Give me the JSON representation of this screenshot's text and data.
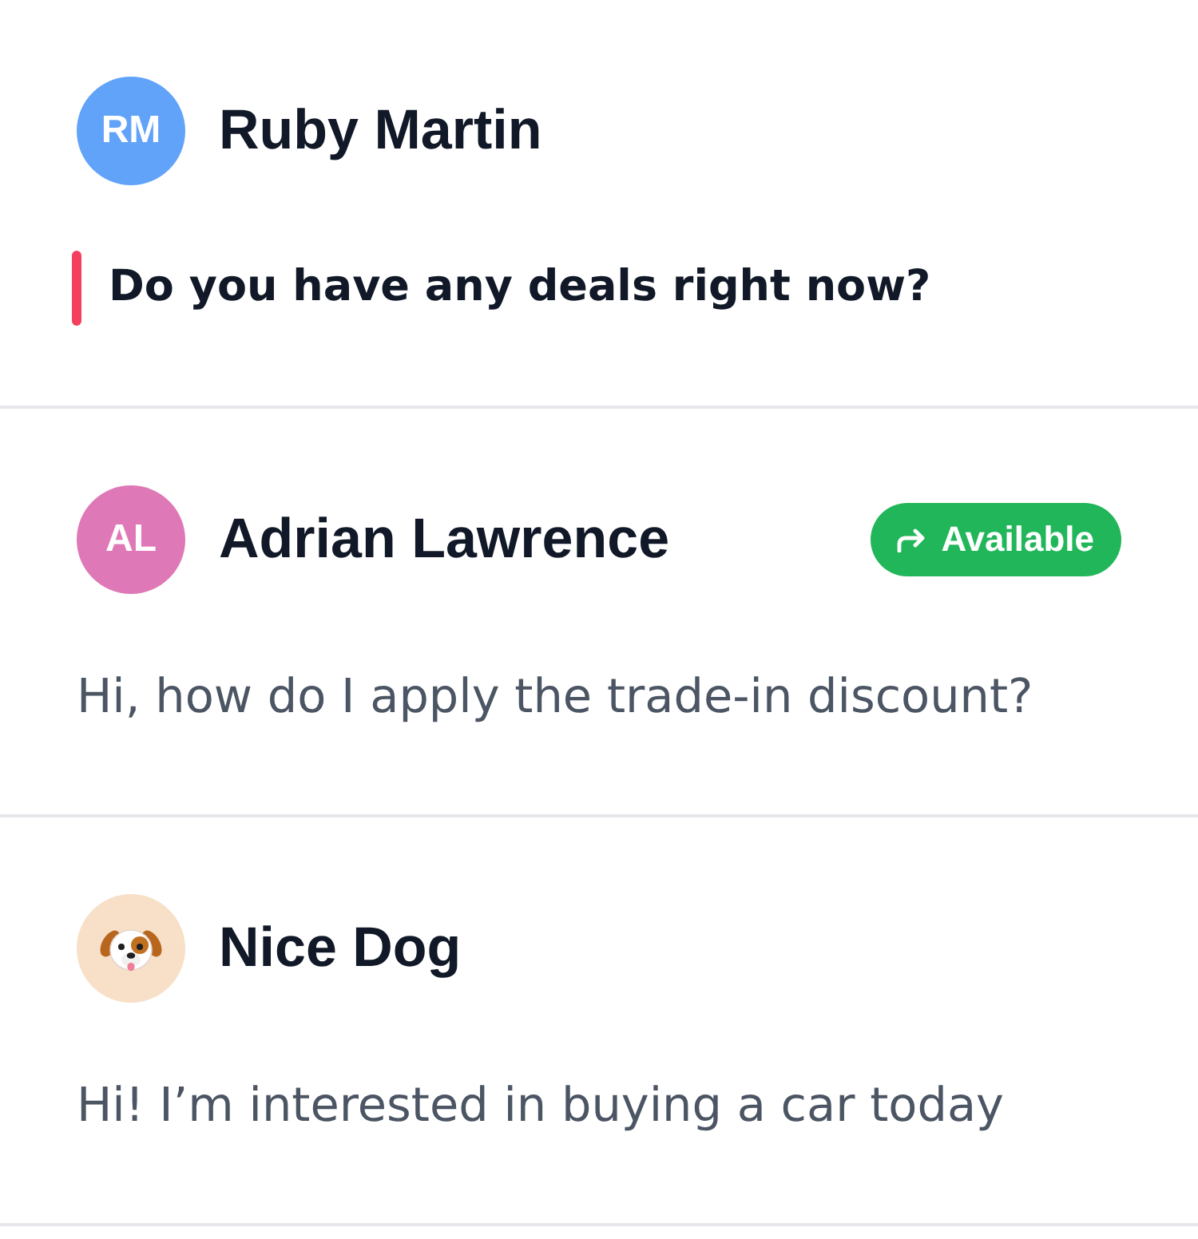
{
  "conversations": [
    {
      "name": "Ruby Martin",
      "avatar": {
        "kind": "initials",
        "text": "RM",
        "color": "#62a3fa"
      },
      "unread": true,
      "message": "Do you have any deals right now?"
    },
    {
      "name": "Adrian Lawrence",
      "avatar": {
        "kind": "initials",
        "text": "AL",
        "color": "#df78b6"
      },
      "status": "Available",
      "unread": false,
      "message": "Hi, how do I apply the trade-in discount?"
    },
    {
      "name": "Nice Dog",
      "avatar": {
        "kind": "emoji",
        "color": "#f8e0c8"
      },
      "unread": false,
      "message": "Hi! I’m interested in buying a car today"
    }
  ]
}
